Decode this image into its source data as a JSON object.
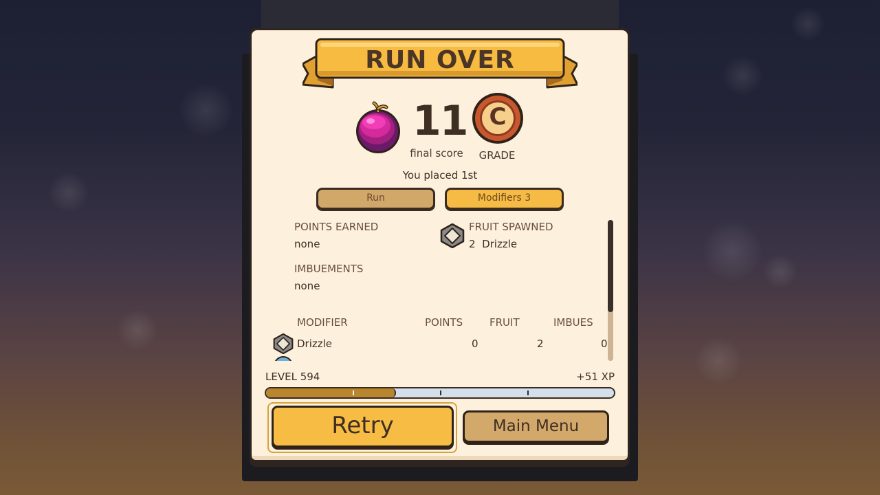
{
  "title": "RUN OVER",
  "score": {
    "value": "11",
    "label": "final score",
    "fruit_icon": "plum-fruit-icon"
  },
  "grade": {
    "letter": "C",
    "label": "GRADE"
  },
  "placement": "You placed 1st",
  "tabs": [
    {
      "label": "Run",
      "active": false
    },
    {
      "label": "Modifiers  3",
      "active": true
    }
  ],
  "summary": {
    "points_earned": {
      "heading": "POINTS EARNED",
      "value": "none"
    },
    "imbuements": {
      "heading": "IMBUEMENTS",
      "value": "none"
    },
    "fruit_spawned": {
      "heading": "FRUIT SPAWNED",
      "value": "2  Drizzle",
      "icon": "diamond-icon"
    }
  },
  "table": {
    "columns": [
      "MODIFIER",
      "POINTS",
      "FRUIT",
      "IMBUES"
    ],
    "rows": [
      {
        "modifier": "Drizzle",
        "points": "0",
        "fruit": "2",
        "imbues": "0",
        "icon": "diamond-icon"
      }
    ]
  },
  "progress": {
    "level_label": "LEVEL 594",
    "xp_gain": "+51 XP",
    "fill_fraction": 0.37
  },
  "buttons": {
    "retry": "Retry",
    "main_menu": "Main Menu"
  },
  "colors": {
    "panel": "#fdf0dd",
    "accent": "#f6bc44",
    "tab_inactive": "#d2a86a",
    "outline": "#2f2219"
  }
}
